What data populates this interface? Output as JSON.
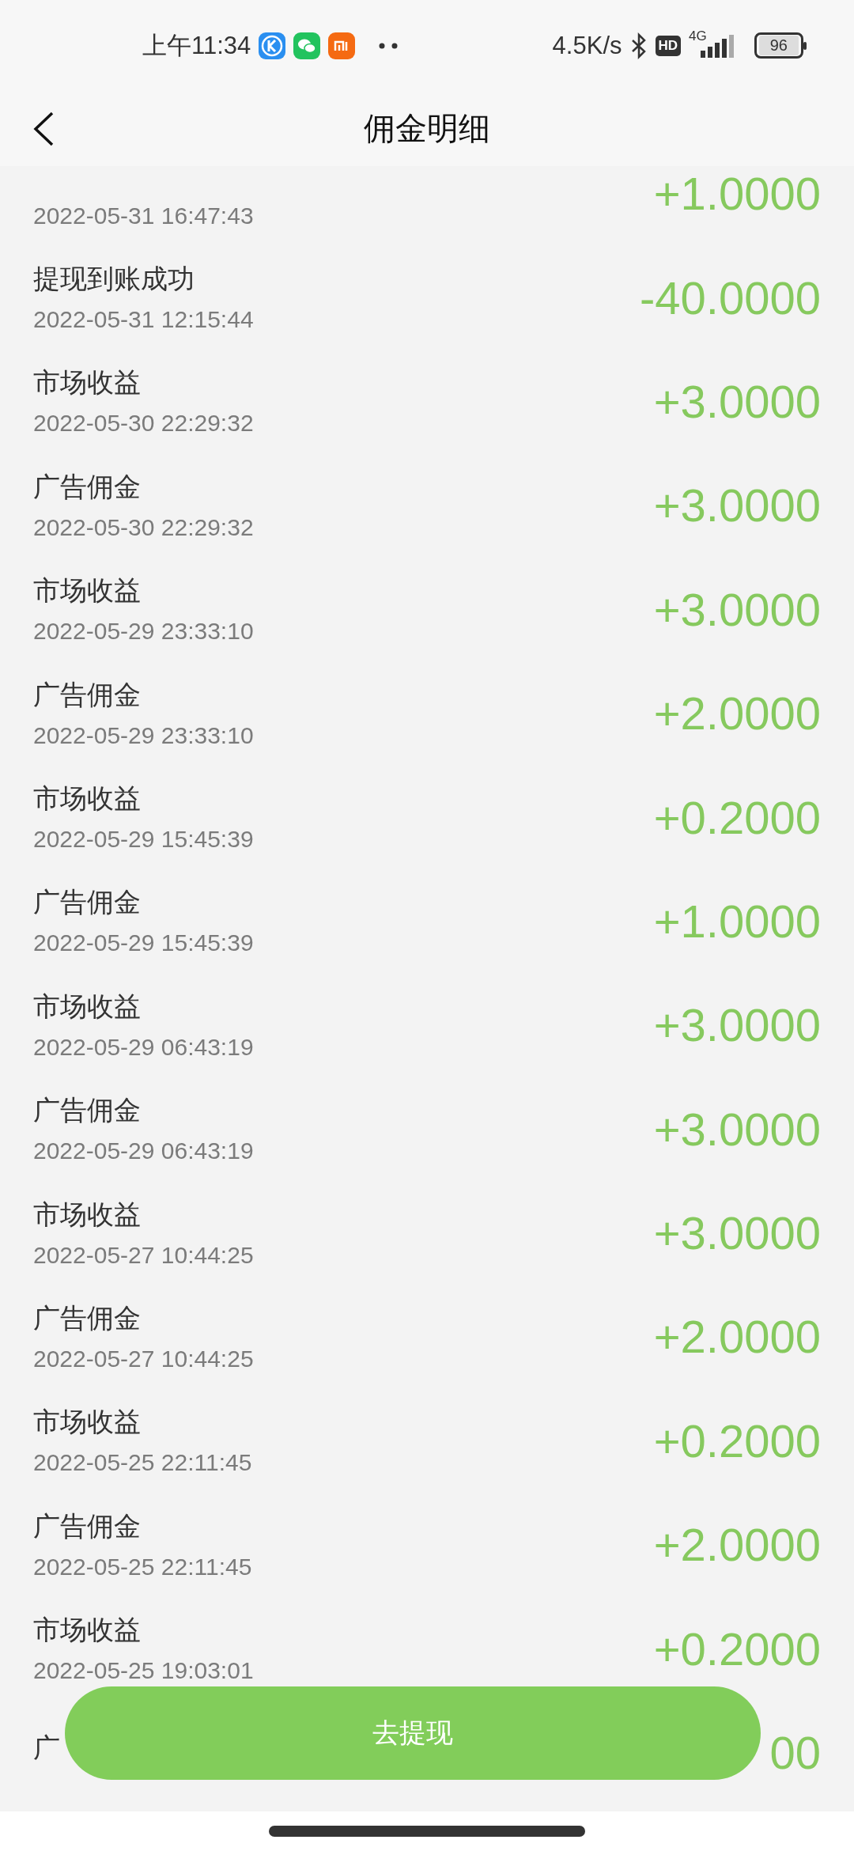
{
  "status_bar": {
    "time": "上午11:34",
    "speed": "4.5K/s",
    "hd": "HD",
    "network": "4G",
    "battery": "96"
  },
  "header": {
    "title": "佣金明细"
  },
  "records": [
    {
      "date": "2022-05-31 16:47:43",
      "amount": "+1.0000"
    },
    {
      "label": "提现到账成功",
      "date": "2022-05-31 12:15:44",
      "amount": "-40.0000"
    },
    {
      "label": "市场收益",
      "date": "2022-05-30 22:29:32",
      "amount": "+3.0000"
    },
    {
      "label": "广告佣金",
      "date": "2022-05-30 22:29:32",
      "amount": "+3.0000"
    },
    {
      "label": "市场收益",
      "date": "2022-05-29 23:33:10",
      "amount": "+3.0000"
    },
    {
      "label": "广告佣金",
      "date": "2022-05-29 23:33:10",
      "amount": "+2.0000"
    },
    {
      "label": "市场收益",
      "date": "2022-05-29 15:45:39",
      "amount": "+0.2000"
    },
    {
      "label": "广告佣金",
      "date": "2022-05-29 15:45:39",
      "amount": "+1.0000"
    },
    {
      "label": "市场收益",
      "date": "2022-05-29 06:43:19",
      "amount": "+3.0000"
    },
    {
      "label": "广告佣金",
      "date": "2022-05-29 06:43:19",
      "amount": "+3.0000"
    },
    {
      "label": "市场收益",
      "date": "2022-05-27 10:44:25",
      "amount": "+3.0000"
    },
    {
      "label": "广告佣金",
      "date": "2022-05-27 10:44:25",
      "amount": "+2.0000"
    },
    {
      "label": "市场收益",
      "date": "2022-05-25 22:11:45",
      "amount": "+0.2000"
    },
    {
      "label": "广告佣金",
      "date": "2022-05-25 22:11:45",
      "amount": "+2.0000"
    },
    {
      "label": "市场收益",
      "date": "2022-05-25 19:03:01",
      "amount": "+0.2000"
    },
    {
      "label": "广",
      "amount": "00"
    }
  ],
  "withdraw_button": {
    "label": "去提现"
  }
}
